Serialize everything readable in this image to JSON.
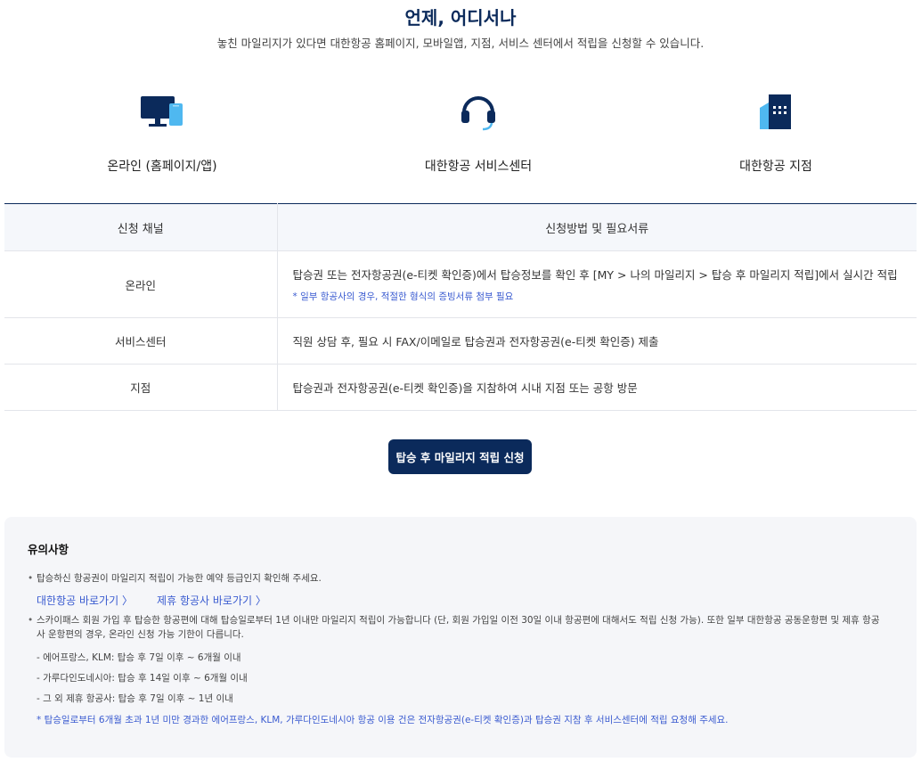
{
  "header": {
    "title": "언제, 어디서나",
    "subtitle": "놓친 마일리지가 있다면 대한항공 홈페이지, 모바일앱, 지점, 서비스 센터에서 적립을 신청할 수 있습니다."
  },
  "channels": [
    {
      "icon": "monitor-phone-icon",
      "label": "온라인 (홈페이지/앱)"
    },
    {
      "icon": "headset-icon",
      "label": "대한항공 서비스센터"
    },
    {
      "icon": "building-icon",
      "label": "대한항공 지점"
    }
  ],
  "table": {
    "headers": [
      "신청 채널",
      "신청방법 및 필요서류"
    ],
    "rows": [
      {
        "channel": "온라인",
        "method": "탑승권 또는 전자항공권(e-티켓 확인증)에서 탑승정보를 확인 후 [MY > 나의 마일리지 > 탑승 후 마일리지 적립]에서 실시간 적립",
        "note": "* 일부 항공사의 경우, 적절한 형식의 증빙서류 첨부 필요"
      },
      {
        "channel": "서비스센터",
        "method": "직원 상담 후, 필요 시 FAX/이메일로 탑승권과 전자항공권(e-티켓 확인증) 제출"
      },
      {
        "channel": "지점",
        "method": "탑승권과 전자항공권(e-티켓 확인증)을 지참하여 시내 지점 또는 공항 방문"
      }
    ]
  },
  "apply_button": "탑승 후 마일리지 적립 신청",
  "notice": {
    "title": "유의사항",
    "item1": "탑승하신 항공권이 마일리지 적립이 가능한 예약 등급인지 확인해 주세요.",
    "link1": "대한항공 바로가기 〉",
    "link2": "제휴 항공사 바로가기 〉",
    "item2": "스카이패스 회원 가입 후 탑승한 항공편에 대해 탑승일로부터 1년 이내만 마일리지 적립이 가능합니다 (단, 회원 가입일 이전 30일 이내 항공편에 대해서도 적립 신청 가능). 또한 일부 대한항공 공동운항편 및 제휴 항공사 운항편의 경우, 온라인 신청 가능 기한이 다릅니다.",
    "sub1": "- 에어프랑스, KLM: 탑승 후 7일 이후 ~ 6개월 이내",
    "sub2": "- 가루다인도네시아: 탑승 후 14일 이후 ~ 6개월 이내",
    "sub3": "- 그 외 제휴 항공사: 탑승 후 7일 이후 ~ 1년 이내",
    "footnote": "* 탑승일로부터 6개월 초과 1년 미만 경과한 에어프랑스, KLM, 가루다인도네시아 항공 이용 건은 전자항공권(e-티켓 확인증)과 탑승권 지참 후 서비스센터에 적립 요청해 주세요."
  },
  "colors": {
    "navy": "#0b2a5b",
    "light_blue": "#4fb8f0",
    "link_blue": "#3a5bd0"
  }
}
